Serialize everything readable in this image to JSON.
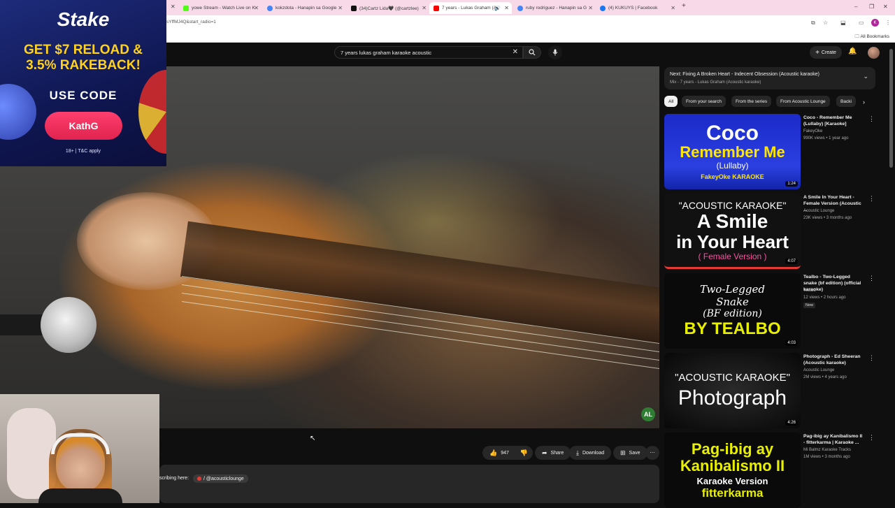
{
  "browser": {
    "tabs": [
      {
        "label": "yowe Stream - Watch Live on K",
        "color": "#53fc18"
      },
      {
        "label": "kokzdota - Hanapin sa Google",
        "color": "#4285f4"
      },
      {
        "label": "(34)Cartz Lida🖤 (@cartzlee)",
        "color": "#111111"
      },
      {
        "label": "7 years - Lukas Graham (A",
        "color": "#ff0000"
      },
      {
        "label": "ruby rodriguez - Hanapin sa G",
        "color": "#4285f4"
      },
      {
        "label": "(4) KUKUYS | Facebook",
        "color": "#1877f2"
      }
    ],
    "url": "sYffMJ4Q&start_radio=1",
    "all_bookmarks": "All Bookmarks"
  },
  "youtube": {
    "search_value": "7 years lukas graham karaoke acoustic",
    "create_label": "Create"
  },
  "ad": {
    "logo": "Stake",
    "headline1": "GET $7 RELOAD &",
    "headline2": "3.5% RAKEBACK!",
    "use_code": "USE CODE",
    "code": "KathG",
    "terms": "18+ | T&C apply"
  },
  "video": {
    "channel_badge": "AL"
  },
  "actions": {
    "likes": "947",
    "share": "Share",
    "download": "Download",
    "save": "Save"
  },
  "description": {
    "subscribe_text": "scribing here:",
    "handle": "/ @acousticlounge"
  },
  "next_up": {
    "title": "Next: Fixing A Broken Heart - Indecent Obsession (Acoustic karaoke)",
    "subtitle": "Mix - 7 years - Lukas Graham (Acoustic karaoke)"
  },
  "chips": [
    "All",
    "From your search",
    "From the series",
    "From Acoustic Lounge",
    "Backi"
  ],
  "recommendations": [
    {
      "title": "Coco - Remember Me (Lullaby) [Karaoke]",
      "channel": "FakeyOke",
      "meta": "990K views • 1 year ago",
      "duration": "1:24",
      "new": ""
    },
    {
      "title": "A Smile In Your Heart - Female Version (Acoustic ...",
      "channel": "Acoustic Lounge",
      "meta": "23K views • 3 months ago",
      "duration": "4:07",
      "new": ""
    },
    {
      "title": "Tealbo - Two-Legged snake (bf edition) (official karaoke)",
      "channel": "Tealbo",
      "meta": "12 views • 2 hours ago",
      "duration": "4:03",
      "new": "New"
    },
    {
      "title": "Photograph - Ed Sheeran (Acoustic karaoke)",
      "channel": "Acoustic Lounge",
      "meta": "2M views • 4 years ago",
      "duration": "4:26",
      "new": ""
    },
    {
      "title": "Pag-ibig ay Kanibalismo II - fitterkarma | Karaoke ...",
      "channel": "Mi Balmz Karaoke Tracks",
      "meta": "1M views • 3 months ago",
      "duration": "",
      "new": ""
    }
  ],
  "thumbs": {
    "coco": {
      "line1": "Coco",
      "line2": "Remember Me",
      "line3": "(Lullaby)",
      "line4": "FakeyOke KARAOKE"
    },
    "smile": {
      "line1": "\"ACOUSTIC KARAOKE\"",
      "line2": "A Smile",
      "line3": "in Your Heart",
      "line4": "( Female Version )"
    },
    "tealbo": {
      "line1": "Two-Legged",
      "line2": "Snake",
      "line3": "(BF edition)",
      "line4": "BY TEALBO"
    },
    "photo": {
      "line1": "\"ACOUSTIC KARAOKE\"",
      "line2": "Photograph"
    },
    "pagibig": {
      "line1": "Pag-ibig ay",
      "line2": "Kanibalismo II",
      "line3": "Karaoke Version",
      "line4": "fitterkarma"
    }
  }
}
